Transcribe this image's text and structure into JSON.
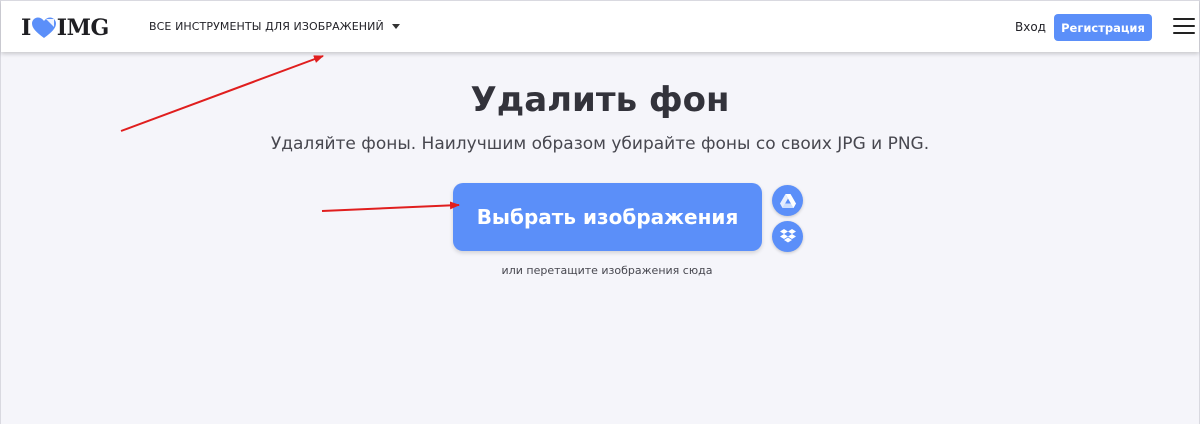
{
  "header": {
    "logo_left": "I",
    "logo_right": "IMG",
    "tools_menu_label": "ВСЕ ИНСТРУМЕНТЫ ДЛЯ ИЗОБРАЖЕНИЙ",
    "login_label": "Вход",
    "register_label": "Регистрация"
  },
  "main": {
    "title": "Удалить фон",
    "subtitle": "Удаляйте фоны. Наилучшим образом убирайте фоны со своих JPG и PNG.",
    "select_button_label": "Выбрать изображения",
    "drop_hint": "или перетащите изображения сюда",
    "cloud_buttons": [
      "google-drive-icon",
      "dropbox-icon"
    ]
  },
  "colors": {
    "accent": "#5b8ff9",
    "annotation_arrow": "#e01e1e",
    "background": "#f5f5fa"
  }
}
